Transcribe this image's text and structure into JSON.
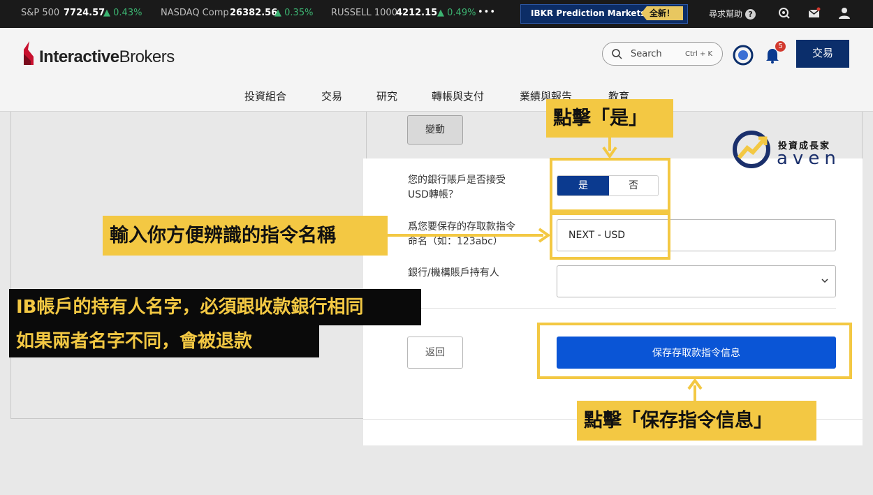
{
  "ticker": {
    "items": [
      {
        "name": "S&P 500",
        "value": "7724.57",
        "change": "0.43%"
      },
      {
        "name": "NASDAQ Comp",
        "value": "26382.56",
        "change": "0.35%"
      },
      {
        "name": "RUSSELL 1000",
        "value": "4212.15",
        "change": "0.49%"
      }
    ],
    "more": "•••",
    "promo_label": "IBKR Prediction Markets",
    "promo_badge": "全新！",
    "help_label": "尋求幫助",
    "help_icon": "?"
  },
  "header": {
    "logo_text_bold": "Interactive",
    "logo_text_rest": "Brokers",
    "search_placeholder": "Search",
    "search_shortcut": "Ctrl + K",
    "notification_count": "5",
    "trade_button": "交易",
    "nav": [
      "投資組合",
      "交易",
      "研究",
      "轉帳與支付",
      "業績與報告",
      "教育"
    ]
  },
  "form": {
    "change_button": "變動",
    "usd_question_line1": "您的銀行賬戶是否接受",
    "usd_question_line2": "USD轉帳？",
    "yes": "是",
    "no": "否",
    "instruction_label_line1": "爲您要保存的存取款指令",
    "instruction_label_line2": "命名（如：123abc）",
    "instruction_value": "NEXT - USD",
    "holder_label": "銀行/機構賬戶持有人",
    "back_button": "返回",
    "save_button": "保存存取款指令信息"
  },
  "annotations": {
    "click_yes": "點擊「是」",
    "enter_name": "輸入你方便辨識的指令名稱",
    "holder_note_line1": "IB帳戶的持有人名字，必須跟收款銀行相同",
    "holder_note_line2": "如果兩者名字不同，會被退款",
    "click_save": "點擊「保存指令信息」"
  },
  "watermark": {
    "cn": "投資成長家",
    "en": "aven"
  },
  "colors": {
    "accent_navy": "#0b2e6b",
    "accent_blue": "#0a55d6",
    "highlight_yellow": "#f3c843",
    "ticker_green": "#3cb371"
  }
}
